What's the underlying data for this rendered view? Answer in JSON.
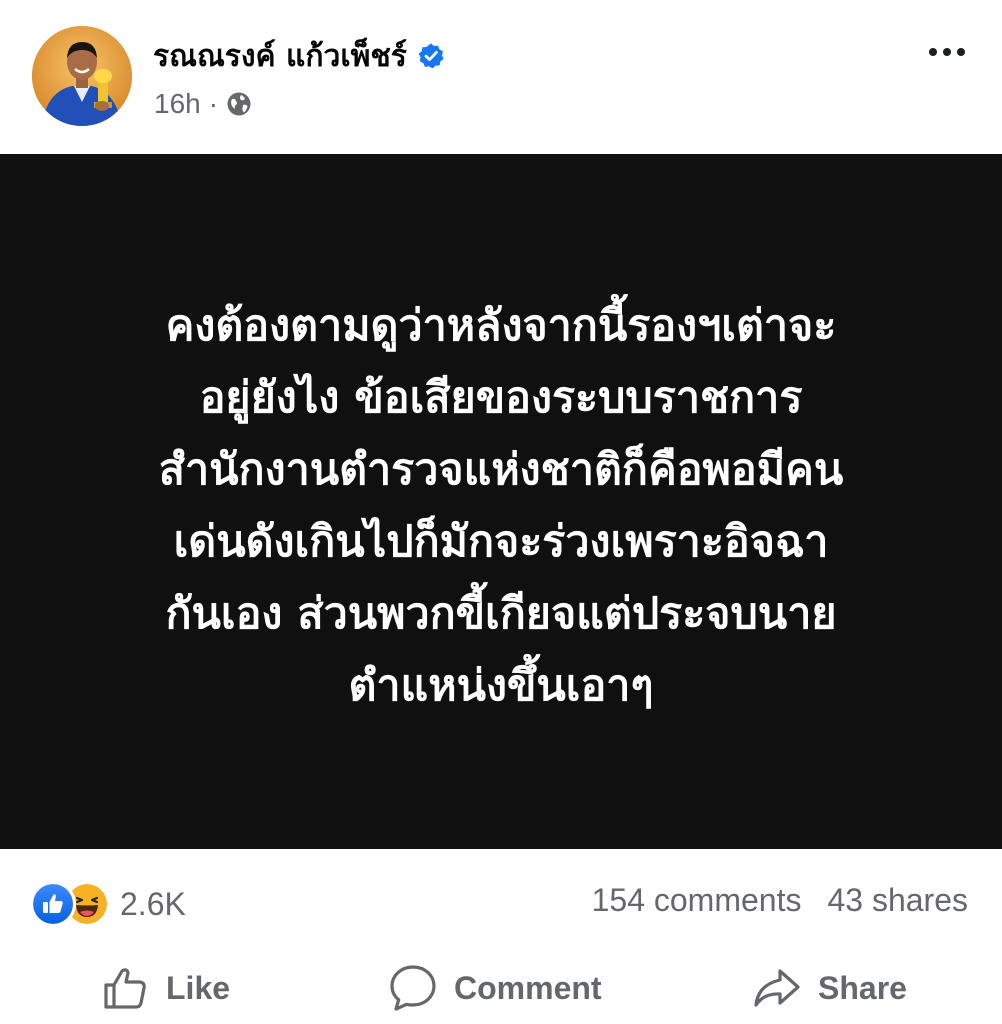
{
  "post": {
    "author": "รณณรงค์ แก้วเพ็ชร์",
    "time": "16h",
    "separator": "·",
    "text": "คงต้องตามดูว่าหลังจากนี้รองฯเต่าจะ\nอยู่ยังไง    ข้อเสียของระบบราชการ\nสำนักงานตำรวจแห่งชาติก็คือพอมีคน\nเด่นดังเกินไปก็มักจะร่วงเพราะอิจฉา\nกันเอง ส่วนพวกขี้เกียจแต่ประจบนาย\nตำแหน่งขึ้นเอาๆ"
  },
  "icons": {
    "verified": "verified-badge-icon",
    "audience": "globe-icon",
    "more": "more-horizontal-icon",
    "reaction_like": "like-reaction-icon",
    "reaction_haha": "haha-reaction-icon",
    "like": "thumbs-up-icon",
    "comment": "comment-bubble-icon",
    "share": "share-arrow-icon"
  },
  "stats": {
    "reactions": "2.6K",
    "comments": "154 comments",
    "shares": "43 shares"
  },
  "actions": {
    "like_label": "Like",
    "comment_label": "Comment",
    "share_label": "Share"
  },
  "colors": {
    "panel_background": "#101010",
    "verified_blue": "#1877f2",
    "secondary_text": "#65676b",
    "haha_yellow": "#f7b125"
  }
}
